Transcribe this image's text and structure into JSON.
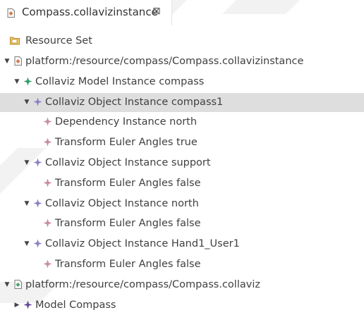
{
  "editor_tab": {
    "title": "Compass.collavizinstance",
    "close_glyph": "⊠",
    "icon": "collaviz-file-icon"
  },
  "tree": {
    "root_label": "Resource Set",
    "selected_index": 2,
    "colors": {
      "selection": "#dedede",
      "model_diamond": "#2e9e6e",
      "object_diamond": "#8a82c8",
      "leaf_diamond": "#c98aa8",
      "model_compass_diamond": "#6b4a9b"
    },
    "nodes": [
      {
        "label": "platform:/resource/compass/Compass.collavizinstance",
        "twisty": "expanded",
        "icon": "resource-file-icon"
      },
      {
        "label": "Collaviz Model Instance compass",
        "twisty": "expanded",
        "icon": "model-instance-icon"
      },
      {
        "label": "Collaviz Object Instance compass1",
        "twisty": "expanded",
        "icon": "object-instance-icon"
      },
      {
        "label": "Dependency Instance north",
        "twisty": "none",
        "icon": "dependency-instance-icon"
      },
      {
        "label": "Transform Euler Angles true",
        "twisty": "none",
        "icon": "transform-icon"
      },
      {
        "label": "Collaviz Object Instance support",
        "twisty": "expanded",
        "icon": "object-instance-icon"
      },
      {
        "label": "Transform Euler Angles false",
        "twisty": "none",
        "icon": "transform-icon"
      },
      {
        "label": "Collaviz Object Instance north",
        "twisty": "expanded",
        "icon": "object-instance-icon"
      },
      {
        "label": "Transform Euler Angles false",
        "twisty": "none",
        "icon": "transform-icon"
      },
      {
        "label": "Collaviz Object Instance Hand1_User1",
        "twisty": "expanded",
        "icon": "object-instance-icon"
      },
      {
        "label": "Transform Euler Angles false",
        "twisty": "none",
        "icon": "transform-icon"
      },
      {
        "label": "platform:/resource/compass/Compass.collaviz",
        "twisty": "expanded",
        "icon": "collaviz-file-icon"
      },
      {
        "label": "Model Compass",
        "twisty": "collapsed",
        "icon": "model-icon"
      }
    ]
  }
}
